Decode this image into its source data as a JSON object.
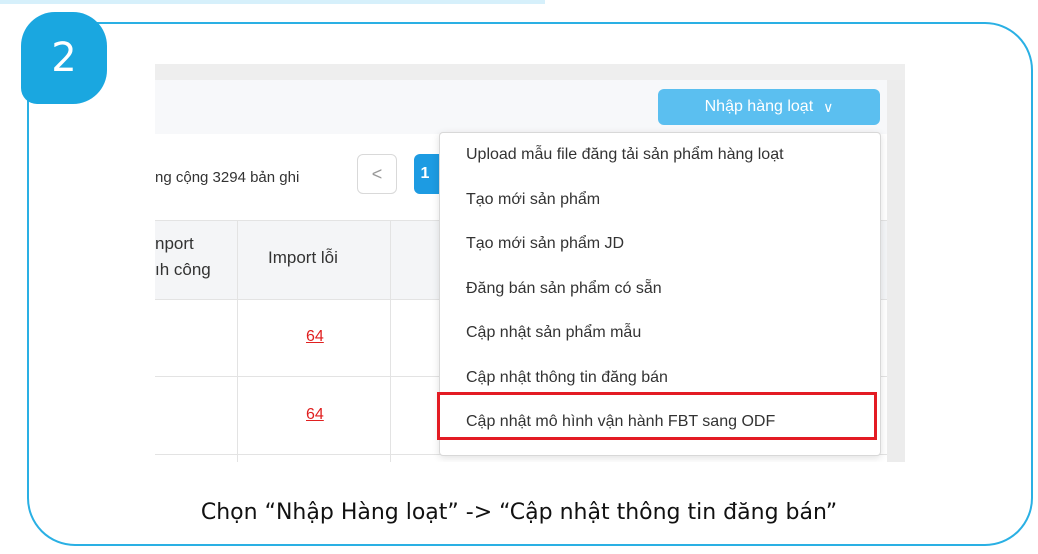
{
  "step_number": "2",
  "toolbar": {
    "import_button_label": "Nhập hàng loạt",
    "import_button_chevron": "∨"
  },
  "pagination": {
    "records_text": "ng cộng 3294 bản ghi",
    "prev_icon": "<",
    "current_page": "1"
  },
  "table": {
    "headers": [
      {
        "line1": "nport",
        "line2": "ıh công"
      },
      {
        "line1": "Import lỗi",
        "line2": ""
      }
    ],
    "rows": [
      {
        "import_error": "64"
      },
      {
        "import_error": "64"
      }
    ]
  },
  "dropdown": {
    "items": [
      "Upload mẫu file đăng tải sản phẩm hàng loạt",
      "Tạo mới sản phẩm",
      "Tạo mới sản phẩm JD",
      "Đăng bán sản phẩm có sẵn",
      "Cập nhật sản phẩm mẫu",
      "Cập nhật thông tin đăng bán",
      "Cập nhật mô hình vận hành FBT sang ODF"
    ]
  },
  "caption": "Chọn “Nhập Hàng loạt” -> “Cập nhật thông tin đăng bán”",
  "colors": {
    "frame": "#2ab0e4",
    "badge": "#1aa7e0",
    "button": "#5bbff0",
    "highlight": "#e31b23",
    "error_link": "#e02020"
  }
}
